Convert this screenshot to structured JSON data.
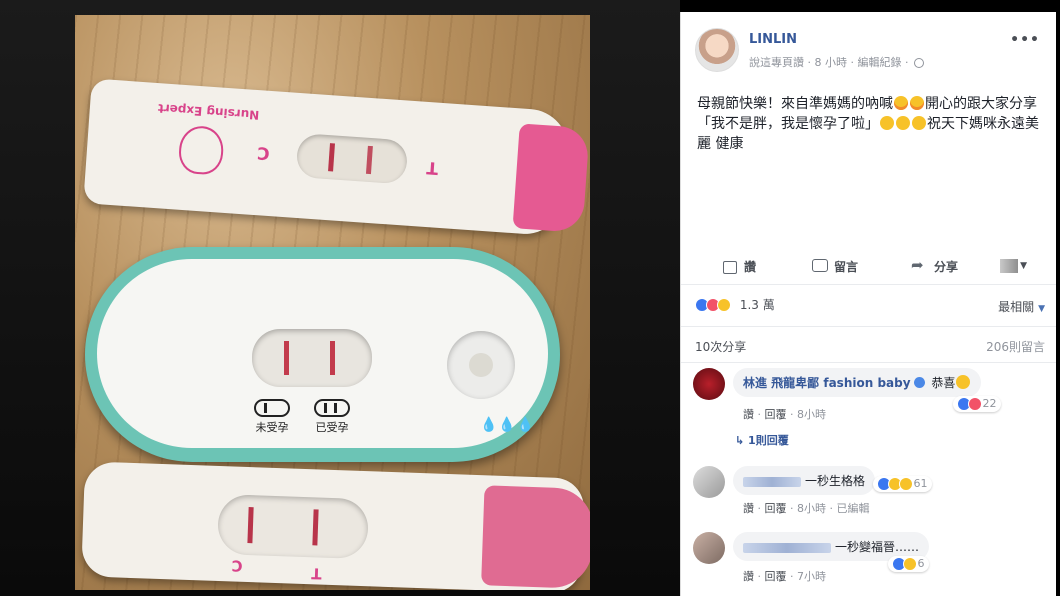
{
  "post": {
    "author": "LINLIN",
    "meta_prefix": "說這專頁讚 · 8 小時 · 編輯紀錄 ·",
    "text_1": "母親節快樂！來自準媽媽的吶喊",
    "text_2": "開心的跟大家分享「我不是胖，我是懷孕了啦」",
    "text_3": "祝天下媽咪永遠美麗 健康"
  },
  "photo": {
    "brand_text": "Nursing Expert",
    "letter_c": "C",
    "letter_t": "T",
    "label_not_pregnant": "未受孕",
    "label_pregnant": "已受孕",
    "drops": "💧💧💧"
  },
  "actions": {
    "like": "讚",
    "comment": "留言",
    "share": "分享"
  },
  "stats": {
    "reaction_count": "1.3 萬",
    "sort": "最相關",
    "shares": "10次分享",
    "comments": "206則留言"
  },
  "comments": [
    {
      "name": "林進 飛龍卑鄙 fashion baby",
      "text": "恭喜",
      "reaction_count": "22",
      "like_label": "讚",
      "reply_label": "回覆",
      "time": "8小時",
      "replies": "1則回覆"
    },
    {
      "text": "一秒生格格",
      "reaction_count": "61",
      "like_label": "讚",
      "reply_label": "回覆",
      "time": "8小時",
      "edited": "已編輯"
    },
    {
      "text": "一秒變福晉……",
      "reaction_count": "6",
      "like_label": "讚",
      "reply_label": "回覆",
      "time": "7小時"
    }
  ],
  "colors": {
    "link_blue": "#365899",
    "like_blue": "#3b77f0",
    "love_red": "#f25268",
    "test_teal": "#6cc4b5",
    "test_pink": "#e55a92"
  }
}
